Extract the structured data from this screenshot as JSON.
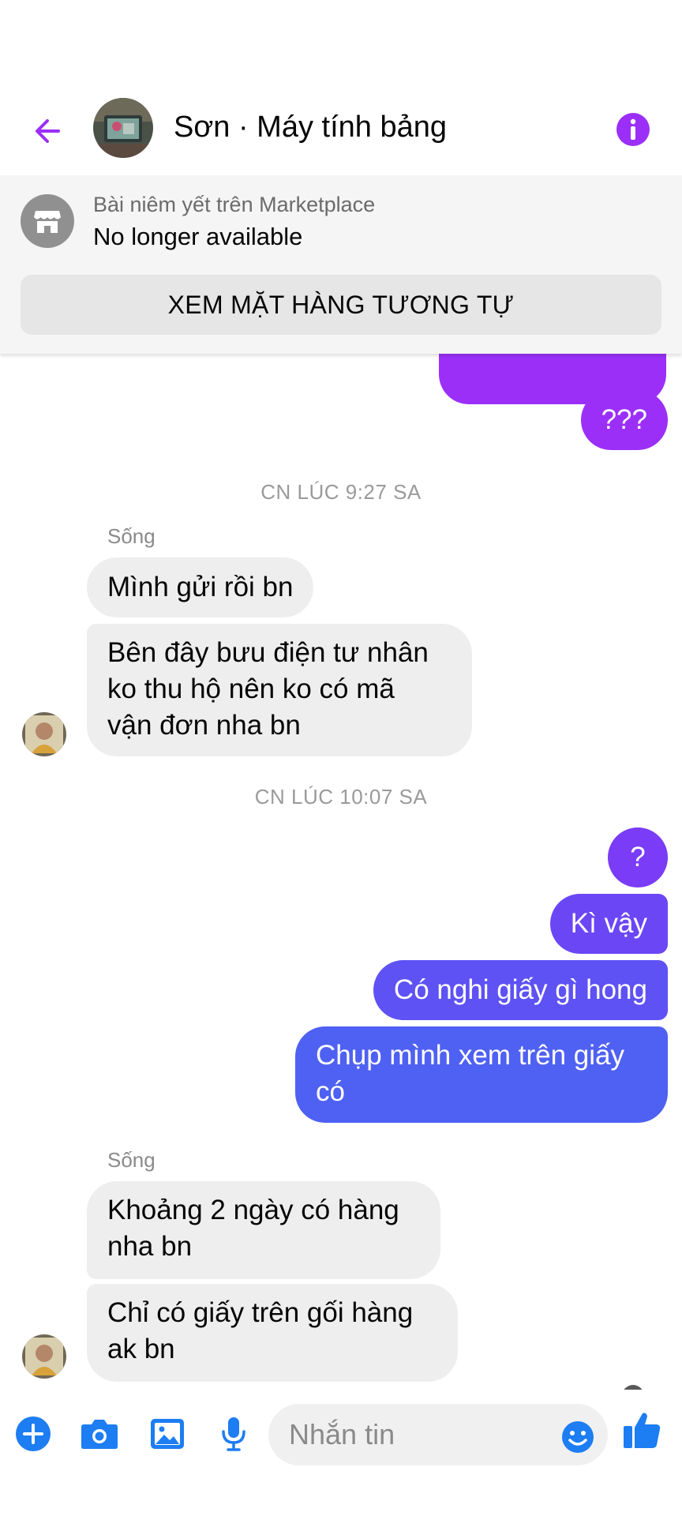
{
  "header": {
    "title": "Sơn · Máy tính bảng",
    "icons": {
      "back": "arrow-left-icon",
      "info": "info-icon"
    },
    "accent": "#9b2ff7"
  },
  "listing_banner": {
    "subtitle": "Bài niêm yết trên Marketplace",
    "status": "No longer available",
    "button_label": "XEM MẶT HÀNG TƯƠNG TỰ",
    "icon": "store-icon"
  },
  "conversation": {
    "messages": {
      "m1": "???",
      "ts1": "CN LÚC 9:27 SA",
      "sender1": "Sống",
      "m2": "Mình gửi rồi bn",
      "m3_l1": "Bên đây bưu điện tư nhân",
      "m3_l2": "ko thu hộ nên ko có mã",
      "m3_l3": "vận đơn nha bn",
      "ts2": "CN LÚC 10:07 SA",
      "m4": "?",
      "m5": "Kì vậy",
      "m6": "Có nghi giấy gì hong",
      "m7_l1": "Chụp mình xem trên giấy",
      "m7_l2": "có",
      "sender2": "Sống",
      "m8_l1": "Khoảng 2 ngày có hàng",
      "m8_l2": "nha bn",
      "m9_l1": "Chỉ có giấy trên gối hàng",
      "m9_l2": "ak bn"
    },
    "colors": {
      "incoming": "#eeeeee",
      "outgoing_purple": "#9b2ff7",
      "outgoing_violet": "#6b4bf5",
      "outgoing_blue": "#4f61f2"
    }
  },
  "composer": {
    "placeholder": "Nhắn tin",
    "icons": [
      "plus-icon",
      "camera-icon",
      "gallery-icon",
      "microphone-icon",
      "emoji-icon",
      "thumbs-up-icon"
    ],
    "accent": "#1d7df2"
  }
}
